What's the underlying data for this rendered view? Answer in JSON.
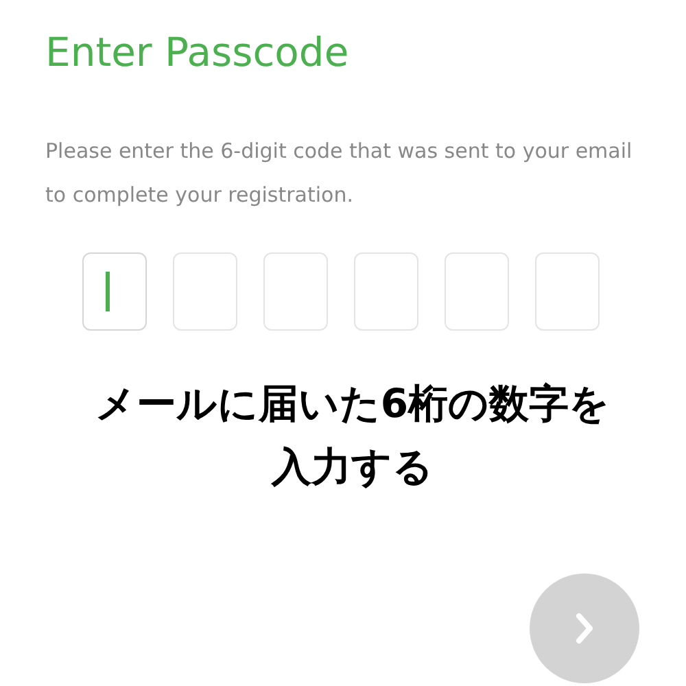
{
  "title": "Enter Passcode",
  "instructions": "Please enter the 6-digit code that was sent to your email to complete your registration.",
  "code_boxes": [
    {
      "focused": true
    },
    {
      "focused": false
    },
    {
      "focused": false
    },
    {
      "focused": false
    },
    {
      "focused": false
    },
    {
      "focused": false
    }
  ],
  "caption": [
    "メールに届いた6桁の数字を",
    "入力する"
  ],
  "next_button": {
    "disabled": true
  }
}
